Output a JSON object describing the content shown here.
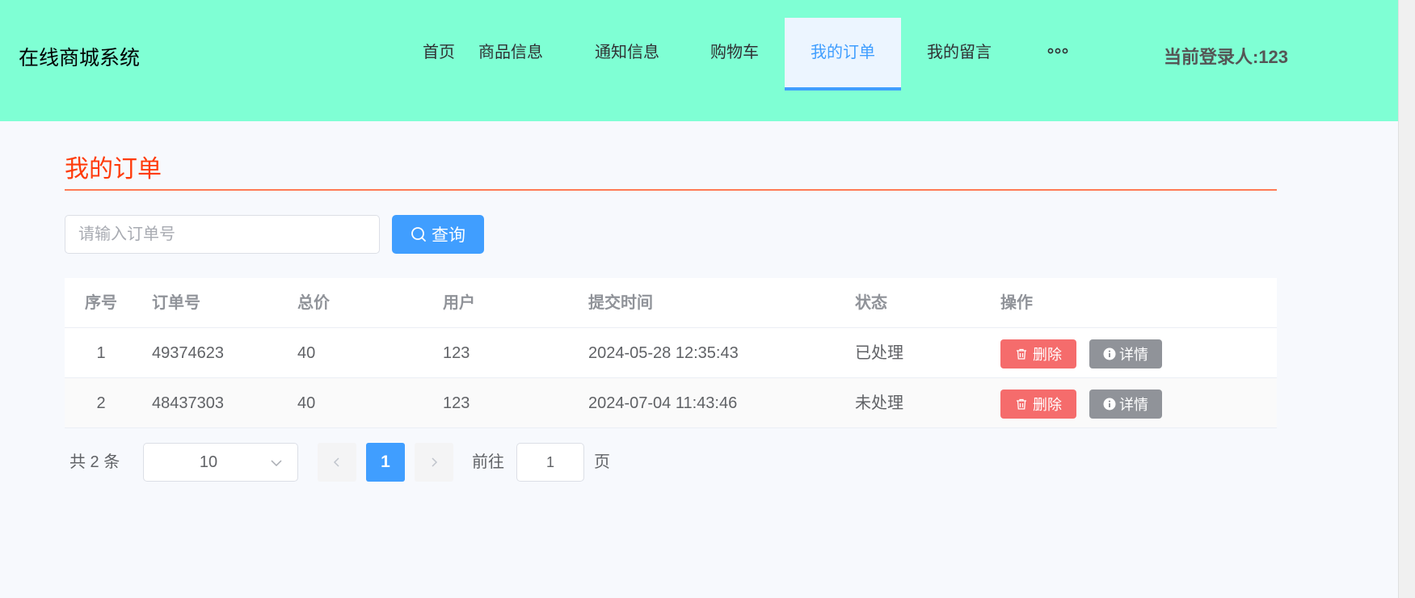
{
  "header": {
    "brand": "在线商城系统",
    "nav": [
      {
        "label": "首页",
        "active": false
      },
      {
        "label": "商品信息",
        "active": false
      },
      {
        "label": "通知信息",
        "active": false
      },
      {
        "label": "购物车",
        "active": false
      },
      {
        "label": "我的订单",
        "active": true
      },
      {
        "label": "我的留言",
        "active": false
      }
    ],
    "more_icon": "more-dots-icon",
    "current_user": "当前登录人:123",
    "colors": {
      "background": "#7fffd4",
      "active_tab": "#409eff"
    }
  },
  "main": {
    "title": "我的订单",
    "title_color": "#ff3b0a",
    "search": {
      "placeholder": "请输入订单号",
      "value": "",
      "button_label": "查询",
      "button_icon": "search-icon"
    },
    "table": {
      "columns": [
        "序号",
        "订单号",
        "总价",
        "用户",
        "提交时间",
        "状态",
        "操作"
      ],
      "rows": [
        {
          "index": "1",
          "order_no": "49374623",
          "total": "40",
          "user": "123",
          "time": "2024-05-28 12:35:43",
          "status": "已处理",
          "delete_label": "删除",
          "detail_label": "详情"
        },
        {
          "index": "2",
          "order_no": "48437303",
          "total": "40",
          "user": "123",
          "time": "2024-07-04 11:43:46",
          "status": "未处理",
          "delete_label": "删除",
          "detail_label": "详情"
        }
      ],
      "delete_icon": "trash-icon",
      "detail_icon": "info-icon",
      "colors": {
        "delete": "#f56c6c",
        "detail": "#909399"
      }
    },
    "pagination": {
      "total_text": "共 2 条",
      "page_size": "10",
      "current_page": "1",
      "goto_label": "前往",
      "goto_value": "1",
      "page_unit": "页"
    }
  }
}
